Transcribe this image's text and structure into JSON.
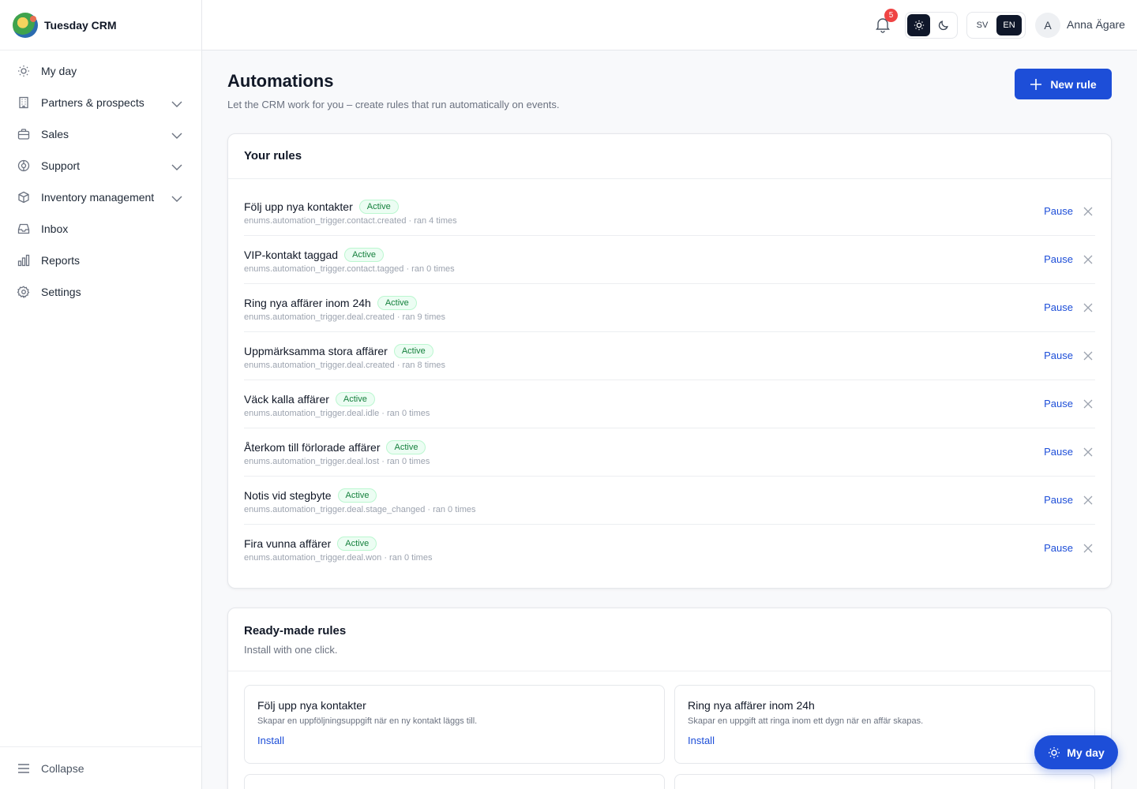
{
  "app": {
    "name": "Tuesday CRM"
  },
  "sidebar": {
    "items": [
      {
        "label": "My day",
        "icon": "sun-icon",
        "expandable": false
      },
      {
        "label": "Partners & prospects",
        "icon": "building-icon",
        "expandable": true
      },
      {
        "label": "Sales",
        "icon": "briefcase-icon",
        "expandable": true
      },
      {
        "label": "Support",
        "icon": "lifebuoy-icon",
        "expandable": true
      },
      {
        "label": "Inventory management",
        "icon": "box-icon",
        "expandable": true
      },
      {
        "label": "Inbox",
        "icon": "inbox-icon",
        "expandable": false
      },
      {
        "label": "Reports",
        "icon": "bar-chart-icon",
        "expandable": false
      },
      {
        "label": "Settings",
        "icon": "gear-icon",
        "expandable": false
      }
    ],
    "collapse_label": "Collapse"
  },
  "topbar": {
    "notification_count": "5",
    "theme": "light",
    "languages": [
      "SV",
      "EN"
    ],
    "active_language": "EN",
    "user_initial": "A",
    "user_name": "Anna Ägare"
  },
  "page": {
    "title": "Automations",
    "subtitle": "Let the CRM work for you – create rules that run automatically on events.",
    "new_rule_label": "New rule"
  },
  "rules": {
    "heading": "Your rules",
    "status_label": "Active",
    "pause_label": "Pause",
    "items": [
      {
        "name": "Följ upp nya kontakter",
        "meta": "enums.automation_trigger.contact.created · ran 4 times"
      },
      {
        "name": "VIP-kontakt taggad",
        "meta": "enums.automation_trigger.contact.tagged · ran 0 times"
      },
      {
        "name": "Ring nya affärer inom 24h",
        "meta": "enums.automation_trigger.deal.created · ran 9 times"
      },
      {
        "name": "Uppmärksamma stora affärer",
        "meta": "enums.automation_trigger.deal.created · ran 8 times"
      },
      {
        "name": "Väck kalla affärer",
        "meta": "enums.automation_trigger.deal.idle · ran 0 times"
      },
      {
        "name": "Återkom till förlorade affärer",
        "meta": "enums.automation_trigger.deal.lost · ran 0 times"
      },
      {
        "name": "Notis vid stegbyte",
        "meta": "enums.automation_trigger.deal.stage_changed · ran 0 times"
      },
      {
        "name": "Fira vunna affärer",
        "meta": "enums.automation_trigger.deal.won · ran 0 times"
      }
    ]
  },
  "ready": {
    "heading": "Ready-made rules",
    "subheading": "Install with one click.",
    "install_label": "Install",
    "templates": [
      {
        "name": "Följ upp nya kontakter",
        "description": "Skapar en uppföljningsuppgift när en ny kontakt läggs till."
      },
      {
        "name": "Ring nya affärer inom 24h",
        "description": "Skapar en uppgift att ringa inom ett dygn när en affär skapas."
      }
    ]
  },
  "fab": {
    "label": "My day"
  },
  "colors": {
    "accent": "#1d4ed8",
    "active_badge": "#15803d",
    "notification": "#ef4444"
  }
}
